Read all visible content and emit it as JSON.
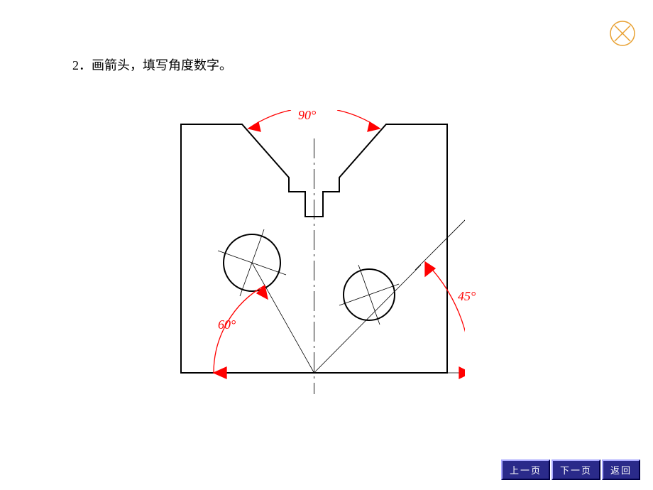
{
  "instruction": "2．画箭头，填写角度数字。",
  "angles": {
    "top": "90°",
    "left": "60°",
    "right": "45°"
  },
  "nav": {
    "prev": "上一页",
    "next": "下一页",
    "back": "返回"
  }
}
